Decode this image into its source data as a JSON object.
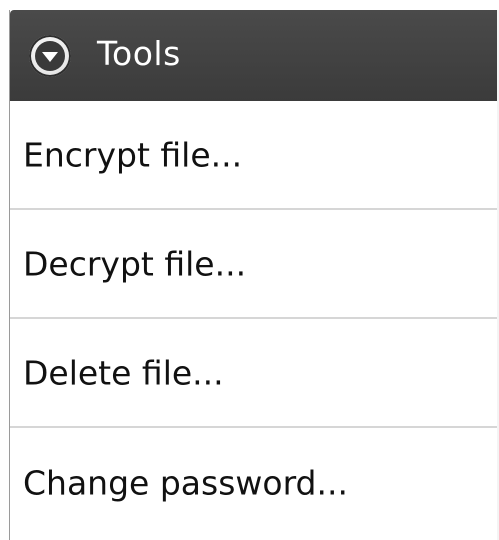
{
  "dialog": {
    "title": "Tools",
    "icon": "dropdown-circle-icon",
    "items": [
      {
        "label": "Encrypt file..."
      },
      {
        "label": "Decrypt file..."
      },
      {
        "label": "Delete file..."
      },
      {
        "label": "Change password..."
      }
    ]
  },
  "colors": {
    "title_bar": "#3b3b3b",
    "title_text": "#ffffff",
    "item_text": "#111111",
    "divider": "#d6d6d6",
    "background": "#ffffff"
  }
}
